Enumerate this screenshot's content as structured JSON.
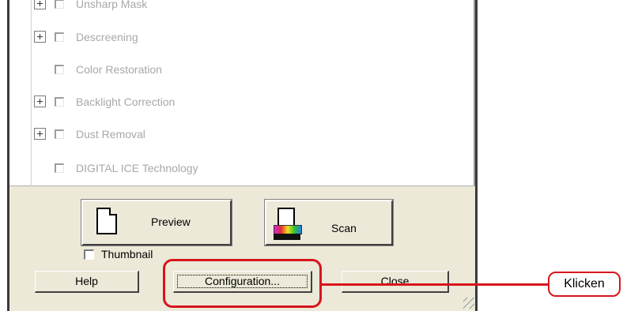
{
  "options": [
    {
      "label": "Unsharp Mask",
      "expandable": true
    },
    {
      "label": "Descreening",
      "expandable": true
    },
    {
      "label": "Color Restoration",
      "expandable": false
    },
    {
      "label": "Backlight Correction",
      "expandable": true
    },
    {
      "label": "Dust Removal",
      "expandable": true
    },
    {
      "label": "DIGITAL ICE Technology",
      "expandable": false
    }
  ],
  "buttons": {
    "preview": "Preview",
    "scan": "Scan",
    "thumbnail": "Thumbnail",
    "help": "Help",
    "configuration": "Configuration...",
    "close": "Close"
  },
  "annotation": {
    "callout_label": "Klicken",
    "color": "#d8141c"
  }
}
